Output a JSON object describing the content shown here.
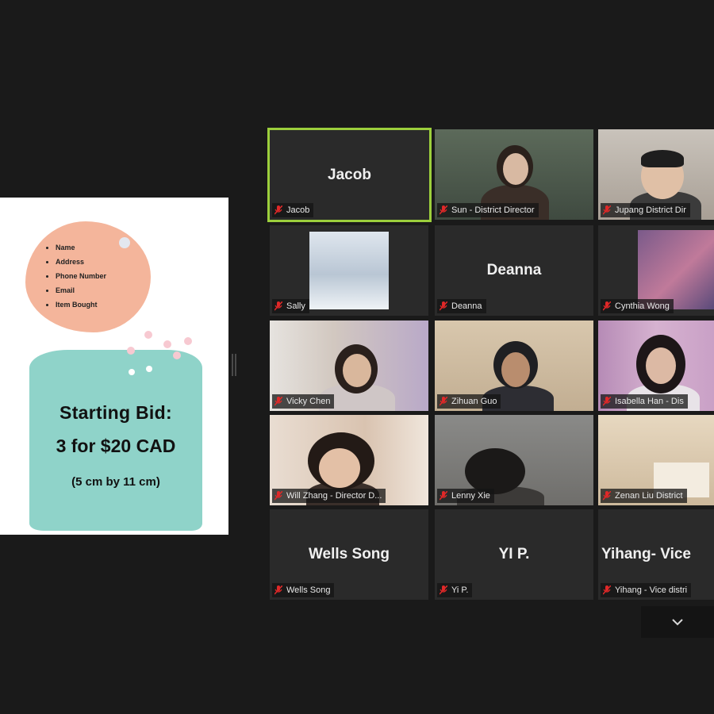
{
  "share": {
    "bullets": [
      "Name",
      "Address",
      "Phone Number",
      "Email",
      "Item Bought"
    ],
    "starting_bid": "Starting Bid:",
    "price": "3 for $20 CAD",
    "size": "(5 cm by 11 cm)"
  },
  "participants": [
    {
      "name": "Jacob",
      "display": "Jacob",
      "video": false,
      "active": true
    },
    {
      "name": "Sun - District Director",
      "video": true
    },
    {
      "name": "Jupang District Dir",
      "video": true
    },
    {
      "name": "Sally",
      "video": false,
      "picture": true
    },
    {
      "name": "Deanna",
      "display": "Deanna",
      "video": false
    },
    {
      "name": "Cynthia Wong",
      "video": false,
      "picture": true
    },
    {
      "name": "Vicky Chen",
      "video": true
    },
    {
      "name": "Zihuan Guo",
      "video": true
    },
    {
      "name": "Isabella Han - Dis",
      "video": true
    },
    {
      "name": "Will Zhang - Director D...",
      "video": true
    },
    {
      "name": "Lenny Xie",
      "video": true
    },
    {
      "name": "Zenan Liu District",
      "video": true
    },
    {
      "name": "Wells Song",
      "display": "Wells Song",
      "video": false
    },
    {
      "name": "Yi P.",
      "display": "YI P.",
      "video": false
    },
    {
      "name": "Yihang - Vice distri",
      "display": "Yihang-  Vice",
      "video": false
    }
  ],
  "icons": {
    "mute": "mic-muted-icon",
    "more": "chevron-down-icon"
  },
  "colors": {
    "active_border": "#9ccf3c",
    "mute_red": "#e02828",
    "background": "#1a1a1a"
  }
}
